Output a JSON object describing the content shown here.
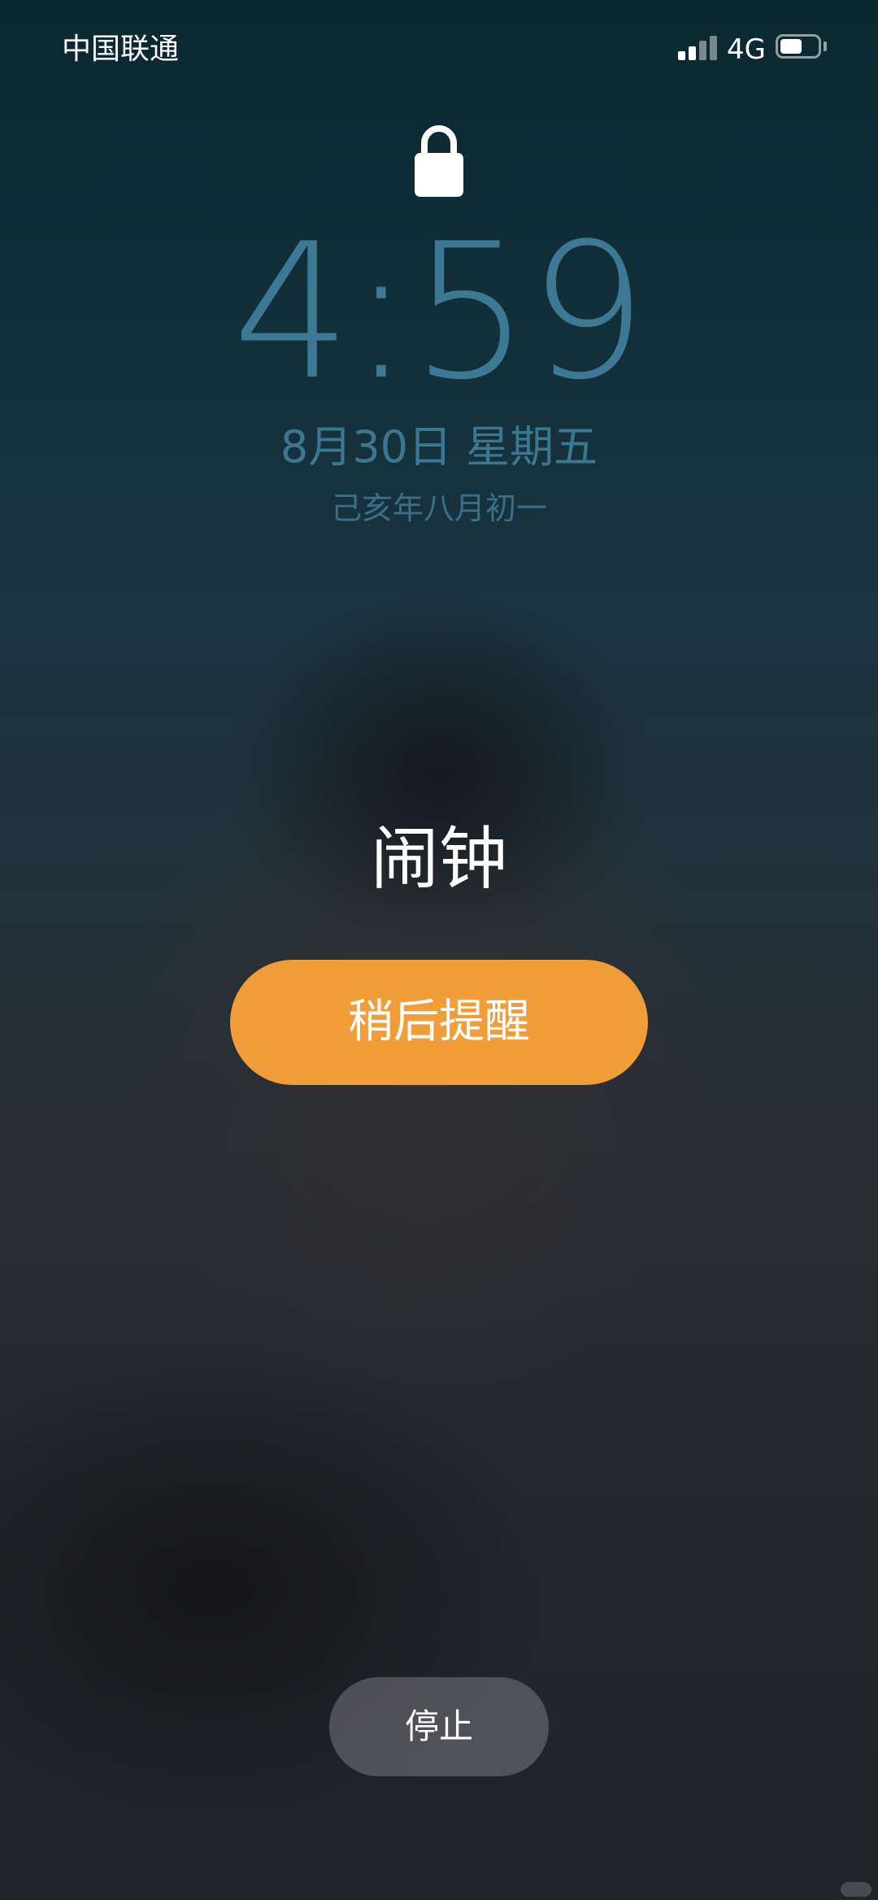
{
  "status_bar": {
    "carrier": "中国联通",
    "network": "4G",
    "signal_bars_active": 2,
    "signal_bars_total": 4,
    "battery_level": 0.6
  },
  "lock_screen": {
    "lock_icon": "lock-icon",
    "time": "4:59",
    "date": "8月30日 星期五",
    "lunar_date": "己亥年八月初一"
  },
  "alarm": {
    "title": "闹钟",
    "snooze_label": "稍后提醒",
    "stop_label": "停止"
  },
  "colors": {
    "snooze_accent": "#f09d3a",
    "clock_text": "#3d7894"
  }
}
